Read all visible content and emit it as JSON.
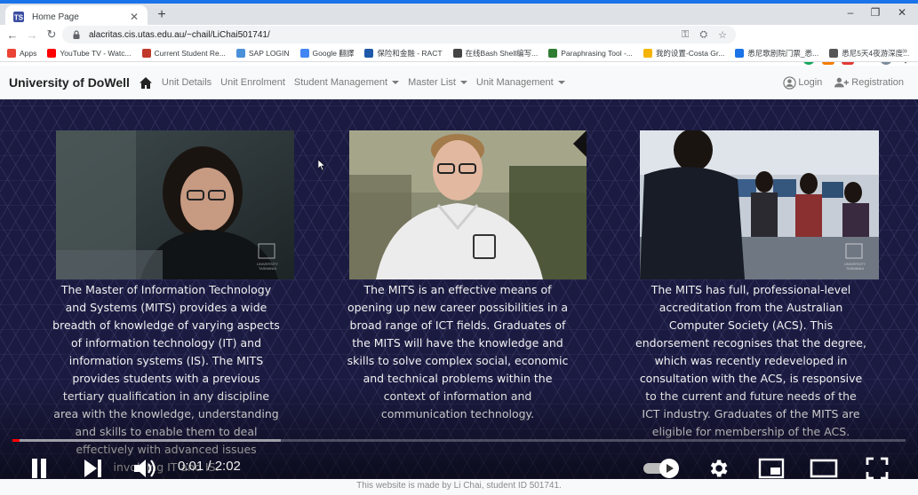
{
  "browser": {
    "tab_title": "Home Page",
    "new_tab": "+",
    "url": "alacritas.cis.utas.edu.au/~chail/LiChai501741/",
    "window_controls": [
      "–",
      "❐",
      "✕"
    ]
  },
  "bookmarks": [
    {
      "label": "Apps",
      "color": "#ea4335"
    },
    {
      "label": "YouTube TV - Watc...",
      "color": "#ff0000"
    },
    {
      "label": "Current Student Re...",
      "color": "#c0392b"
    },
    {
      "label": "SAP LOGIN",
      "color": "#4a90d9"
    },
    {
      "label": "Google 翻譯",
      "color": "#4285f4"
    },
    {
      "label": "保险和金融 - RACT",
      "color": "#1e5aa8"
    },
    {
      "label": "在线Bash Shell编写...",
      "color": "#444444"
    },
    {
      "label": "Paraphrasing Tool -...",
      "color": "#2e7d32"
    },
    {
      "label": "我的设置-Costa Gr...",
      "color": "#f4b400"
    },
    {
      "label": "悉尼歌剧院门票_悉...",
      "color": "#1a73e8"
    },
    {
      "label": "悉尼5天4夜游深度...",
      "color": "#555555"
    }
  ],
  "site": {
    "brand": "University of DoWell",
    "nav": [
      {
        "label": "Unit Details",
        "dropdown": false
      },
      {
        "label": "Unit Enrolment",
        "dropdown": false
      },
      {
        "label": "Student Management",
        "dropdown": true
      },
      {
        "label": "Master List",
        "dropdown": true
      },
      {
        "label": "Unit Management",
        "dropdown": true
      }
    ],
    "login": "Login",
    "registration": "Registration",
    "footer": "This website is made by Li Chai, student ID 501741."
  },
  "video": {
    "captions": [
      "The Master of Information Technology and Systems (MITS) provides a wide breadth of knowledge of varying aspects of information technology (IT) and information systems (IS). The MITS provides students with a previous tertiary qualification in any discipline area with the knowledge, understanding and skills to enable them to deal effectively with advanced issues involving IT and IS.",
      "The MITS is an effective means of opening up new career possibilities in a broad range of ICT fields. Graduates of the MITS will have the knowledge and skills to solve complex social, economic and technical problems within the context of information and communication technology.",
      "The MITS has full, professional-level accreditation from the Australian Computer Society (ACS). This endorsement recognises that the degree, which was recently redeveloped in consultation with the ACS, is responsive to the current and future needs of the ICT industry. Graduates of the MITS are eligible for membership of the ACS."
    ],
    "watermark": "UNIVERSITY of TASMANIA",
    "time": "0:01 / 2:02",
    "played_fraction": 0.008,
    "loaded_fraction": 0.3,
    "accent": "#ff0000"
  }
}
